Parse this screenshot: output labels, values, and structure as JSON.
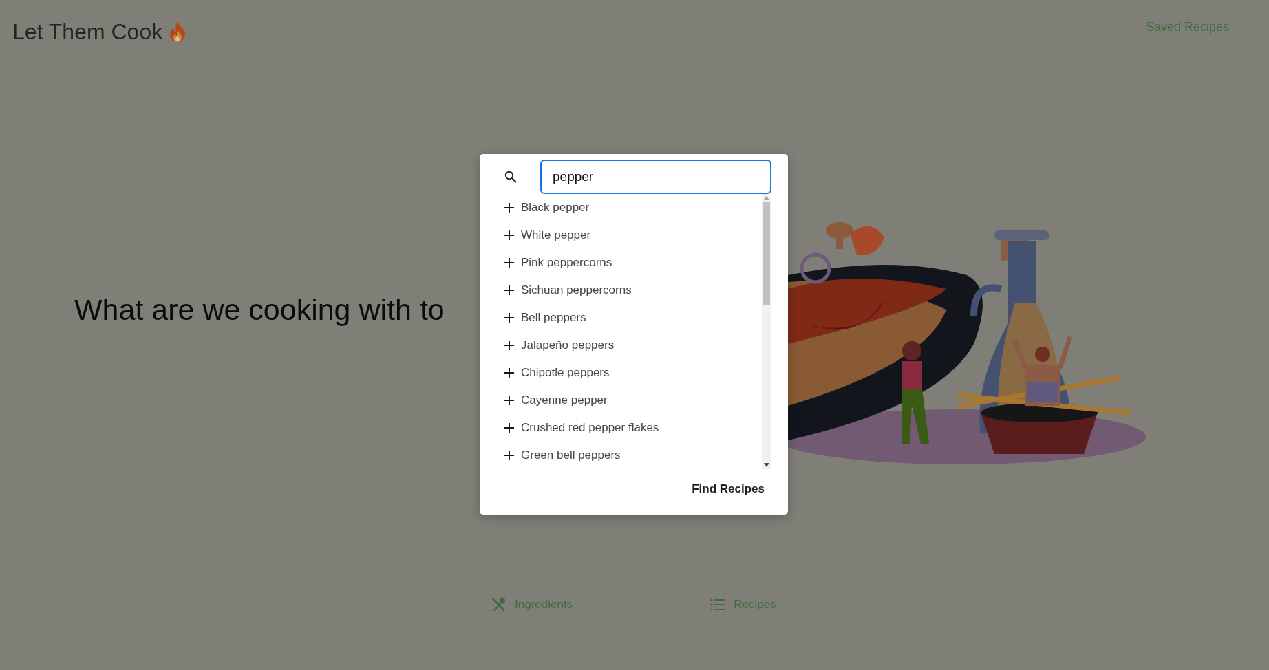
{
  "header": {
    "title": "Let Them Cook",
    "nav_link": "Saved Recipes"
  },
  "hero": {
    "heading": "What are we cooking with to"
  },
  "search_dialog": {
    "query": "pepper",
    "results": [
      {
        "label": "Black pepper"
      },
      {
        "label": "White pepper"
      },
      {
        "label": "Pink peppercorns"
      },
      {
        "label": "Sichuan peppercorns"
      },
      {
        "label": "Bell peppers"
      },
      {
        "label": "Jalapeño peppers"
      },
      {
        "label": "Chipotle peppers"
      },
      {
        "label": "Cayenne pepper"
      },
      {
        "label": "Crushed red pepper flakes"
      },
      {
        "label": "Green bell peppers"
      }
    ],
    "action": "Find Recipes"
  },
  "bottom_nav": [
    {
      "kind": "ingredients",
      "label": "Ingredients"
    },
    {
      "kind": "recipes",
      "label": "Recipes"
    }
  ]
}
